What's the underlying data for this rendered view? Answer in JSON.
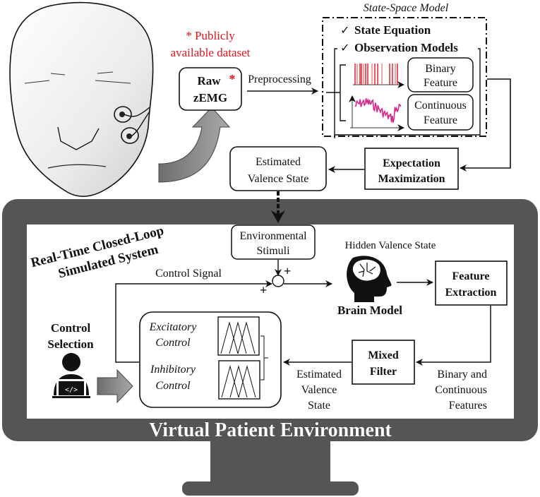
{
  "dataset_note": {
    "line1": "* Publicly",
    "line2": "available dataset",
    "color": "#e0141e"
  },
  "raw_zemg": {
    "line1": "Raw",
    "line2": "zEMG",
    "asterisk": "*"
  },
  "preprocessing_label": "Preprocessing",
  "state_space_model": {
    "title": "State-Space Model",
    "items": [
      {
        "check": "✓",
        "label": "State Equation"
      },
      {
        "check": "✓",
        "label": "Observation Models"
      }
    ],
    "binary_feature": {
      "line1": "Binary",
      "line2": "Feature",
      "color": "#e0141e"
    },
    "continuous_feature": {
      "line1": "Continuous",
      "line2": "Feature",
      "color": "#d6288a"
    }
  },
  "expectation_maximization": {
    "line1": "Expectation",
    "line2": "Maximization"
  },
  "estimated_valence_top": {
    "line1": "Estimated",
    "line2": "Valence State"
  },
  "system_title": {
    "line1": "Real-Time Closed-Loop",
    "line2": "Simulated System"
  },
  "environmental_stimuli": {
    "line1": "Environmental",
    "line2": "Stimuli"
  },
  "plus_sign": "+",
  "control_signal_label": "Control Signal",
  "hidden_valence_label": "Hidden Valence State",
  "brain_model_label": "Brain Model",
  "feature_extraction": {
    "line1": "Feature",
    "line2": "Extraction"
  },
  "control_selection": {
    "line1": "Control",
    "line2": "Selection",
    "code_glyph": "</>"
  },
  "controller": {
    "excitatory": {
      "line1": "Excitatory",
      "line2": "Control"
    },
    "inhibitory": {
      "line1": "Inhibitory",
      "line2": "Control"
    }
  },
  "mixed_filter": {
    "line1": "Mixed",
    "line2": "Filter"
  },
  "estimated_valence_bottom": {
    "line1": "Estimated",
    "line2": "Valence",
    "line3": "State"
  },
  "features_label": {
    "line1": "Binary and",
    "line2": "Continuous",
    "line3": "Features"
  },
  "monitor_caption": "Virtual Patient Environment",
  "colors": {
    "monitor": "#555555",
    "arrow_gray": "#8a8a8a"
  }
}
